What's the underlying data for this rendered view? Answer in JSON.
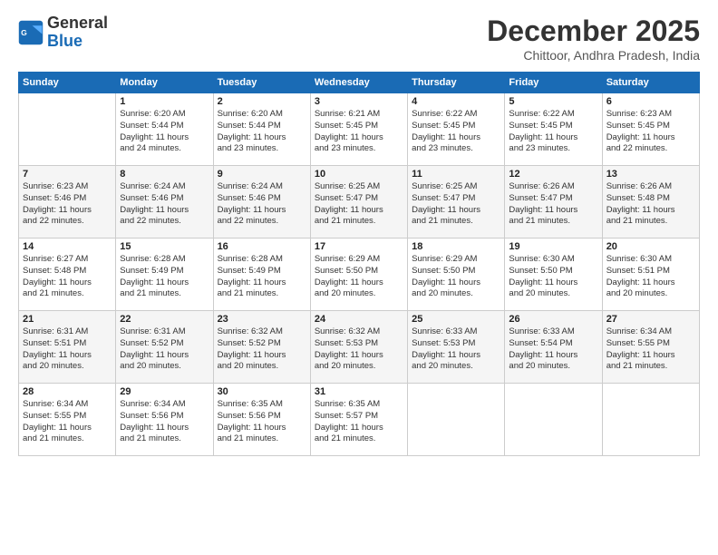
{
  "logo": {
    "line1": "General",
    "line2": "Blue"
  },
  "title": "December 2025",
  "subtitle": "Chittoor, Andhra Pradesh, India",
  "days_of_week": [
    "Sunday",
    "Monday",
    "Tuesday",
    "Wednesday",
    "Thursday",
    "Friday",
    "Saturday"
  ],
  "weeks": [
    [
      {
        "day": "",
        "info": ""
      },
      {
        "day": "1",
        "sunrise": "6:20 AM",
        "sunset": "5:44 PM",
        "daylight": "11 hours and 24 minutes."
      },
      {
        "day": "2",
        "sunrise": "6:20 AM",
        "sunset": "5:44 PM",
        "daylight": "11 hours and 23 minutes."
      },
      {
        "day": "3",
        "sunrise": "6:21 AM",
        "sunset": "5:45 PM",
        "daylight": "11 hours and 23 minutes."
      },
      {
        "day": "4",
        "sunrise": "6:22 AM",
        "sunset": "5:45 PM",
        "daylight": "11 hours and 23 minutes."
      },
      {
        "day": "5",
        "sunrise": "6:22 AM",
        "sunset": "5:45 PM",
        "daylight": "11 hours and 23 minutes."
      },
      {
        "day": "6",
        "sunrise": "6:23 AM",
        "sunset": "5:45 PM",
        "daylight": "11 hours and 22 minutes."
      }
    ],
    [
      {
        "day": "7",
        "sunrise": "6:23 AM",
        "sunset": "5:46 PM",
        "daylight": "11 hours and 22 minutes."
      },
      {
        "day": "8",
        "sunrise": "6:24 AM",
        "sunset": "5:46 PM",
        "daylight": "11 hours and 22 minutes."
      },
      {
        "day": "9",
        "sunrise": "6:24 AM",
        "sunset": "5:46 PM",
        "daylight": "11 hours and 22 minutes."
      },
      {
        "day": "10",
        "sunrise": "6:25 AM",
        "sunset": "5:47 PM",
        "daylight": "11 hours and 21 minutes."
      },
      {
        "day": "11",
        "sunrise": "6:25 AM",
        "sunset": "5:47 PM",
        "daylight": "11 hours and 21 minutes."
      },
      {
        "day": "12",
        "sunrise": "6:26 AM",
        "sunset": "5:47 PM",
        "daylight": "11 hours and 21 minutes."
      },
      {
        "day": "13",
        "sunrise": "6:26 AM",
        "sunset": "5:48 PM",
        "daylight": "11 hours and 21 minutes."
      }
    ],
    [
      {
        "day": "14",
        "sunrise": "6:27 AM",
        "sunset": "5:48 PM",
        "daylight": "11 hours and 21 minutes."
      },
      {
        "day": "15",
        "sunrise": "6:28 AM",
        "sunset": "5:49 PM",
        "daylight": "11 hours and 21 minutes."
      },
      {
        "day": "16",
        "sunrise": "6:28 AM",
        "sunset": "5:49 PM",
        "daylight": "11 hours and 21 minutes."
      },
      {
        "day": "17",
        "sunrise": "6:29 AM",
        "sunset": "5:50 PM",
        "daylight": "11 hours and 20 minutes."
      },
      {
        "day": "18",
        "sunrise": "6:29 AM",
        "sunset": "5:50 PM",
        "daylight": "11 hours and 20 minutes."
      },
      {
        "day": "19",
        "sunrise": "6:30 AM",
        "sunset": "5:50 PM",
        "daylight": "11 hours and 20 minutes."
      },
      {
        "day": "20",
        "sunrise": "6:30 AM",
        "sunset": "5:51 PM",
        "daylight": "11 hours and 20 minutes."
      }
    ],
    [
      {
        "day": "21",
        "sunrise": "6:31 AM",
        "sunset": "5:51 PM",
        "daylight": "11 hours and 20 minutes."
      },
      {
        "day": "22",
        "sunrise": "6:31 AM",
        "sunset": "5:52 PM",
        "daylight": "11 hours and 20 minutes."
      },
      {
        "day": "23",
        "sunrise": "6:32 AM",
        "sunset": "5:52 PM",
        "daylight": "11 hours and 20 minutes."
      },
      {
        "day": "24",
        "sunrise": "6:32 AM",
        "sunset": "5:53 PM",
        "daylight": "11 hours and 20 minutes."
      },
      {
        "day": "25",
        "sunrise": "6:33 AM",
        "sunset": "5:53 PM",
        "daylight": "11 hours and 20 minutes."
      },
      {
        "day": "26",
        "sunrise": "6:33 AM",
        "sunset": "5:54 PM",
        "daylight": "11 hours and 20 minutes."
      },
      {
        "day": "27",
        "sunrise": "6:34 AM",
        "sunset": "5:55 PM",
        "daylight": "11 hours and 21 minutes."
      }
    ],
    [
      {
        "day": "28",
        "sunrise": "6:34 AM",
        "sunset": "5:55 PM",
        "daylight": "11 hours and 21 minutes."
      },
      {
        "day": "29",
        "sunrise": "6:34 AM",
        "sunset": "5:56 PM",
        "daylight": "11 hours and 21 minutes."
      },
      {
        "day": "30",
        "sunrise": "6:35 AM",
        "sunset": "5:56 PM",
        "daylight": "11 hours and 21 minutes."
      },
      {
        "day": "31",
        "sunrise": "6:35 AM",
        "sunset": "5:57 PM",
        "daylight": "11 hours and 21 minutes."
      },
      {
        "day": "",
        "info": ""
      },
      {
        "day": "",
        "info": ""
      },
      {
        "day": "",
        "info": ""
      }
    ]
  ]
}
